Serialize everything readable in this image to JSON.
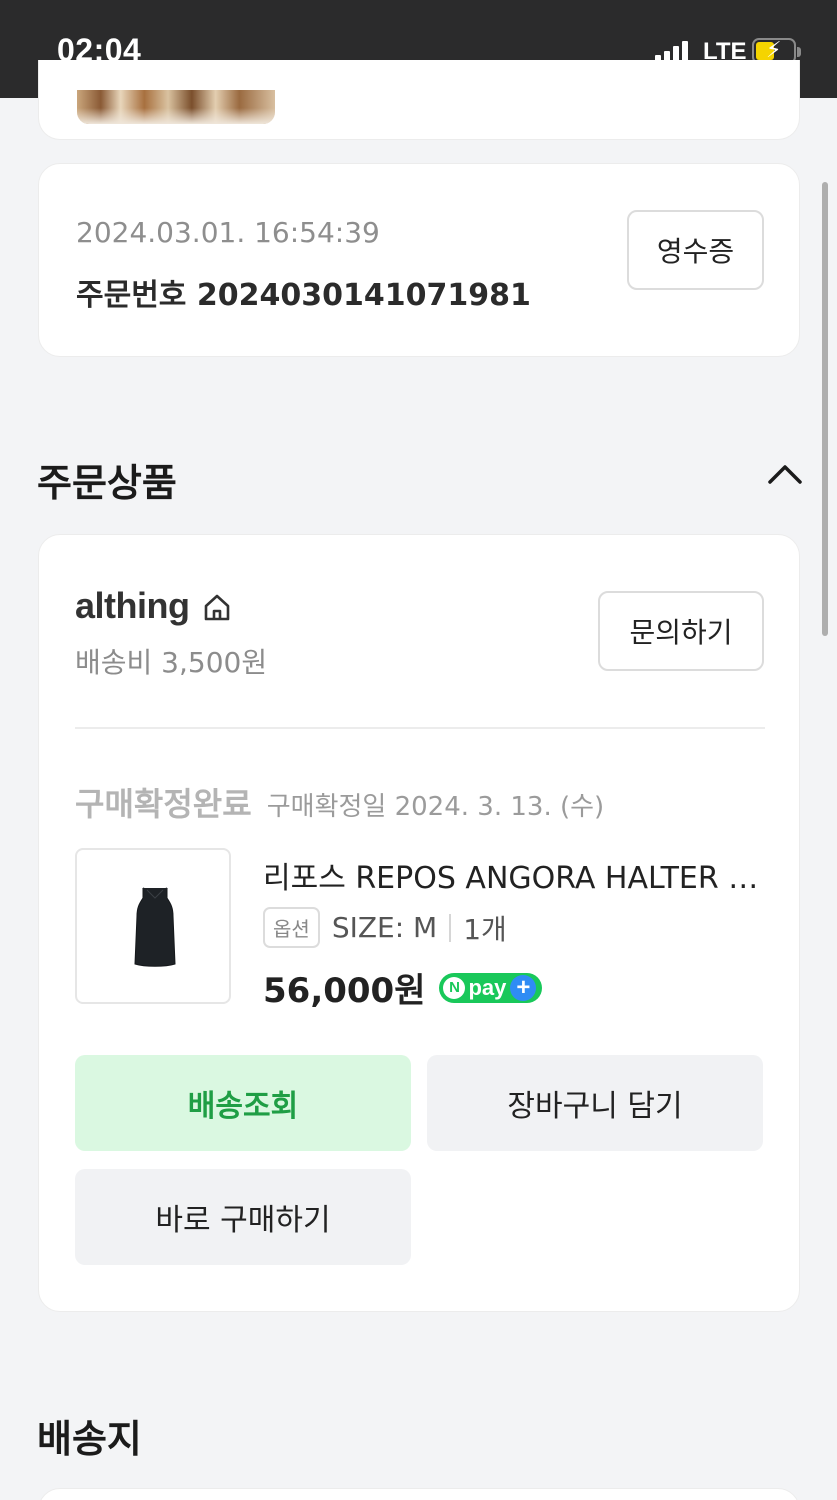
{
  "status_bar": {
    "time": "02:04",
    "network": "LTE",
    "icons": [
      "signal-icon",
      "battery-charging-icon"
    ]
  },
  "order": {
    "date": "2024.03.01. 16:54:39",
    "number": "주문번호 2024030141071981",
    "receipt_label": "영수증"
  },
  "ordered_items": {
    "title": "주문상품",
    "toggle_icon": "chevron-up-icon",
    "seller": {
      "name": "althing",
      "icon": "home-icon",
      "shipping_fee": "배송비 3,500원",
      "inquiry_label": "문의하기"
    },
    "status": {
      "label": "구매확정완료",
      "date": "구매확정일 2024. 3. 13. (수)"
    },
    "product": {
      "name": "리포스 REPOS ANGORA HALTER TOP",
      "option_badge": "옵션",
      "size": "SIZE: M",
      "quantity": "1개",
      "price": "56,000원",
      "npay_label": "pay",
      "npay_n": "N",
      "npay_plus": "+"
    },
    "actions": {
      "track": "배송조회",
      "cart": "장바구니 담기",
      "buy_now": "바로 구매하기"
    }
  },
  "delivery": {
    "title": "배송지"
  },
  "colors": {
    "accent_green": "#1f9e45",
    "track_button_bg": "#daf8e1",
    "npay_green": "#19c85a"
  }
}
